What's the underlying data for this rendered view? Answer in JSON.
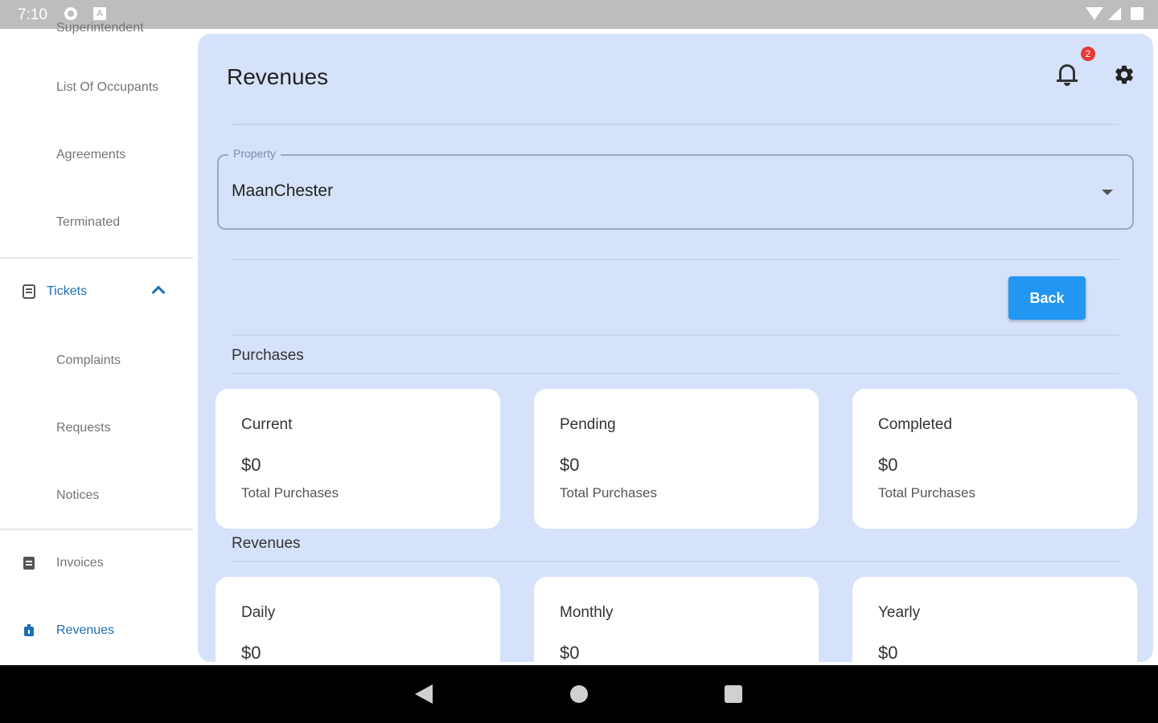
{
  "status_bar": {
    "time": "7:10"
  },
  "sidebar": {
    "top_partial_label": "Superintendent",
    "occupants_items": [
      {
        "label": "List Of Occupants"
      },
      {
        "label": "Agreements"
      },
      {
        "label": "Terminated"
      }
    ],
    "tickets_section": {
      "label": "Tickets",
      "icon": "ticket-icon",
      "expanded": true
    },
    "tickets_items": [
      {
        "label": "Complaints"
      },
      {
        "label": "Requests"
      },
      {
        "label": "Notices"
      }
    ],
    "invoices": {
      "label": "Invoices",
      "icon": "invoice-icon"
    },
    "revenues": {
      "label": "Revenues",
      "icon": "revenue-icon",
      "active": true
    }
  },
  "header": {
    "title": "Revenues",
    "notification_count": "2"
  },
  "property_select": {
    "label": "Property",
    "value": "MaanChester"
  },
  "back_button": {
    "label": "Back"
  },
  "purchases": {
    "title": "Purchases",
    "cards": [
      {
        "title": "Current",
        "value": "$0",
        "subtitle": "Total Purchases"
      },
      {
        "title": "Pending",
        "value": "$0",
        "subtitle": "Total Purchases"
      },
      {
        "title": "Completed",
        "value": "$0",
        "subtitle": "Total Purchases"
      }
    ]
  },
  "revenues": {
    "title": "Revenues",
    "cards": [
      {
        "title": "Daily",
        "value": "$0"
      },
      {
        "title": "Monthly",
        "value": "$0"
      },
      {
        "title": "Yearly",
        "value": "$0"
      }
    ]
  },
  "colors": {
    "accent": "#2196f3",
    "active_nav": "#1e6fb3",
    "panel_bg": "#d6e2fa",
    "badge": "#e53935"
  }
}
